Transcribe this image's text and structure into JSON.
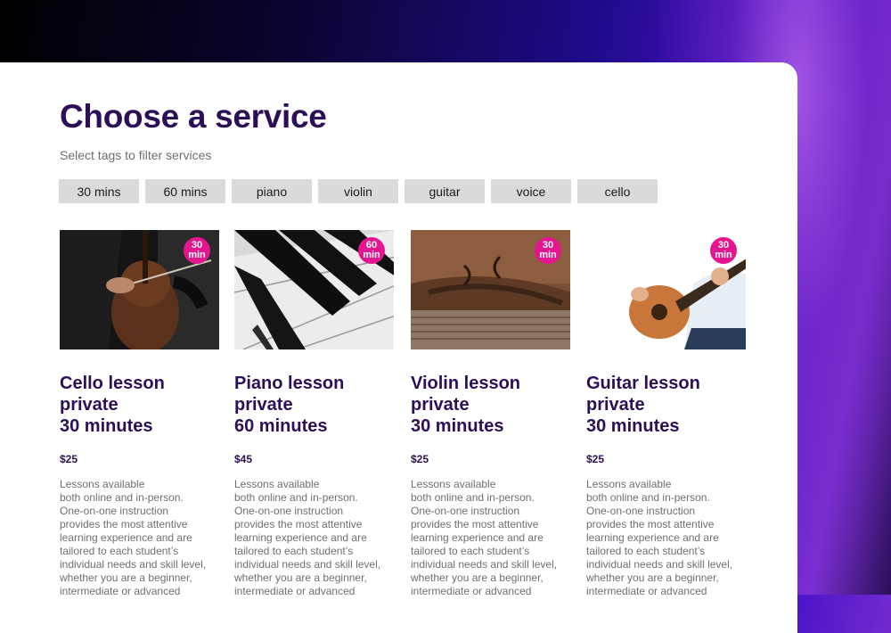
{
  "page": {
    "title": "Choose a service",
    "subtitle": "Select tags to filter services"
  },
  "tags": [
    "30 mins",
    "60 mins",
    "piano",
    "violin",
    "guitar",
    "voice",
    "cello"
  ],
  "badge_color": "#e4168f",
  "title_color": "#2c0f57",
  "services": [
    {
      "badge": [
        "30",
        "min"
      ],
      "title": [
        "Cello lesson",
        "private",
        "30 minutes"
      ],
      "price": "$25",
      "image": "cello-photo",
      "description": [
        "Lessons available",
        "both online and in-person.",
        "One-on-one instruction",
        "provides the most attentive",
        "learning experience and are",
        "tailored to each student’s",
        "individual needs and skill level,",
        "whether you are a beginner,",
        "intermediate or advanced"
      ]
    },
    {
      "badge": [
        "60",
        "min"
      ],
      "title": [
        "Piano lesson",
        "private",
        "60 minutes"
      ],
      "price": "$45",
      "image": "piano-keys-photo",
      "description": [
        "Lessons available",
        "both online and in-person.",
        "One-on-one instruction",
        "provides the most attentive",
        "learning experience and are",
        "tailored to each student’s",
        "individual needs and skill level,",
        "whether you are a beginner,",
        "intermediate or advanced"
      ]
    },
    {
      "badge": [
        "30",
        "min"
      ],
      "title": [
        "Violin lesson",
        "private",
        "30 minutes"
      ],
      "price": "$25",
      "image": "violin-photo",
      "description": [
        "Lessons available",
        "both online and in-person.",
        "One-on-one instruction",
        "provides the most attentive",
        "learning experience and are",
        "tailored to each student’s",
        "individual needs and skill level,",
        "whether you are a beginner,",
        "intermediate or advanced"
      ]
    },
    {
      "badge": [
        "30",
        "min"
      ],
      "title": [
        "Guitar lesson",
        "private",
        "30 minutes"
      ],
      "price": "$25",
      "image": "guitar-photo",
      "description": [
        "Lessons available",
        "both online and in-person.",
        "One-on-one instruction",
        "provides the most attentive",
        "learning experience and are",
        "tailored to each student’s",
        "individual needs and skill level,",
        "whether you are a beginner,",
        "intermediate or advanced"
      ]
    }
  ]
}
